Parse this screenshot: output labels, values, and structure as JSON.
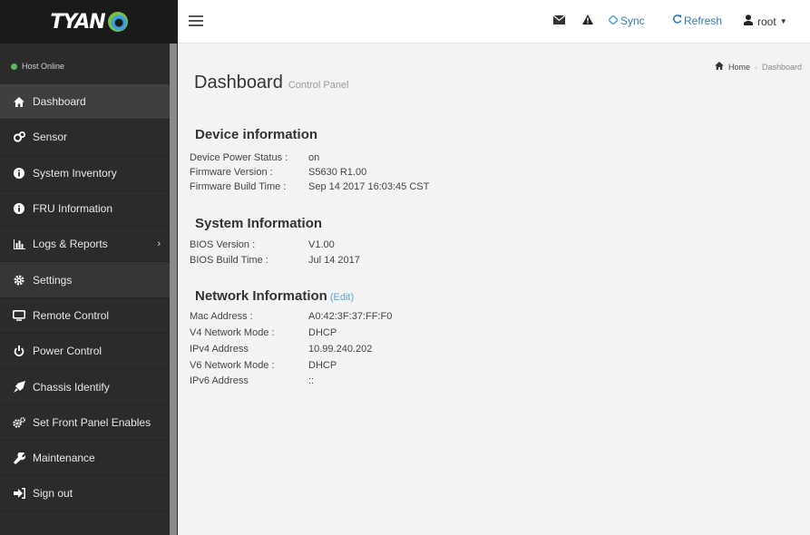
{
  "brand": {
    "logo_text": "TYAN"
  },
  "host_status": "Host Online",
  "sidebar": {
    "items": [
      {
        "label": "Dashboard",
        "icon": "home-icon"
      },
      {
        "label": "Sensor",
        "icon": "sensor-icon"
      },
      {
        "label": "System Inventory",
        "icon": "info-icon"
      },
      {
        "label": "FRU Information",
        "icon": "info-icon"
      },
      {
        "label": "Logs & Reports",
        "icon": "bar-chart-icon"
      },
      {
        "label": "Settings",
        "icon": "gear-icon"
      },
      {
        "label": "Remote Control",
        "icon": "monitor-icon"
      },
      {
        "label": "Power Control",
        "icon": "power-icon"
      },
      {
        "label": "Chassis Identify",
        "icon": "rocket-icon"
      },
      {
        "label": "Set Front Panel Enables",
        "icon": "cogs-icon"
      },
      {
        "label": "Maintenance",
        "icon": "wrench-icon"
      },
      {
        "label": "Sign out",
        "icon": "sign-out-icon"
      }
    ]
  },
  "topbar": {
    "sync_label": "Sync",
    "refresh_label": "Refresh",
    "user_label": "root"
  },
  "page": {
    "title": "Dashboard",
    "subtitle": "Control Panel"
  },
  "breadcrumb": {
    "home": "Home",
    "current": "Dashboard"
  },
  "device_info": {
    "title": "Device information",
    "rows": [
      {
        "label": "Device Power Status :",
        "value": "on"
      },
      {
        "label": "Firmware Version :",
        "value": "S5630 R1.00"
      },
      {
        "label": "Firmware Build Time :",
        "value": "Sep 14 2017 16:03:45 CST"
      }
    ]
  },
  "system_info": {
    "title": "System Information",
    "rows": [
      {
        "label": "BIOS Version :",
        "value": "V1.00"
      },
      {
        "label": "BIOS Build Time :",
        "value": "Jul 14 2017"
      }
    ]
  },
  "network_info": {
    "title": "Network Information",
    "edit_label": "(Edit)",
    "rows": [
      {
        "label": "Mac Address :",
        "value": "A0:42:3F:37:FF:F0"
      },
      {
        "label": "V4 Network Mode :",
        "value": "DHCP"
      },
      {
        "label": "IPv4 Address",
        "value": "10.99.240.202"
      },
      {
        "label": "V6 Network Mode :",
        "value": "DHCP"
      },
      {
        "label": "IPv6 Address",
        "value": "::"
      }
    ]
  },
  "colors": {
    "sidebar_bg": "#2b2b2b",
    "logo_bg": "#1a1a1a",
    "status_green": "#5cb85c",
    "link_blue": "#337ab7"
  }
}
